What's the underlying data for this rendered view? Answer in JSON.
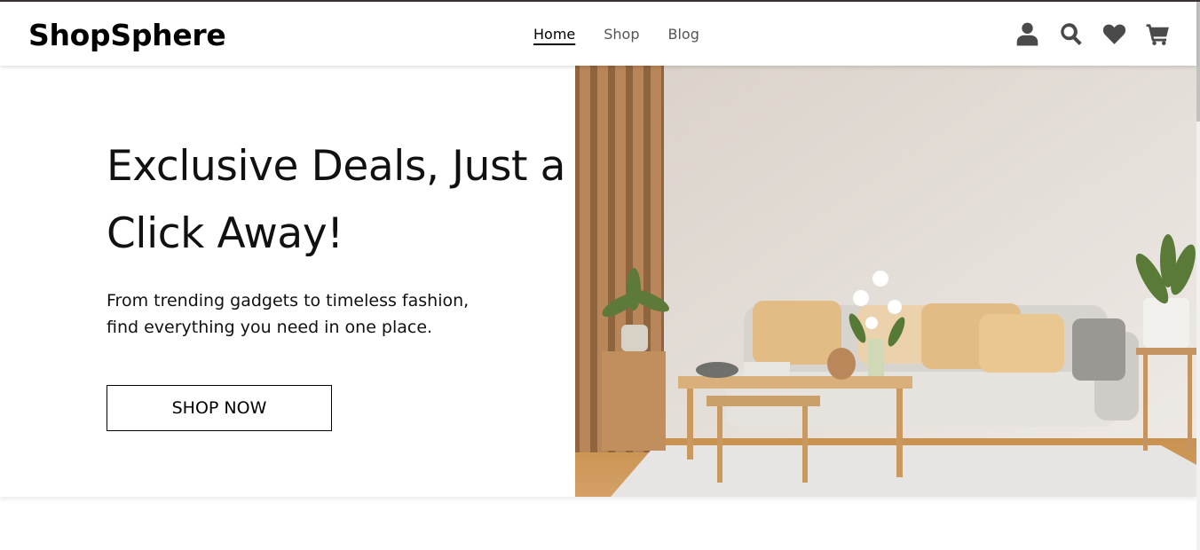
{
  "brand": {
    "name": "ShopSphere"
  },
  "nav": {
    "items": [
      "Home",
      "Shop",
      "Blog"
    ],
    "active": "Home"
  },
  "header_icons": [
    "user-icon",
    "search-icon",
    "heart-icon",
    "cart-icon"
  ],
  "hero": {
    "title": "Exclusive Deals, Just a Click Away!",
    "subtitle": "From trending gadgets to timeless fashion, find everything you need in one place.",
    "cta_label": "SHOP NOW",
    "image": "living-room-sofa-photo"
  },
  "colors": {
    "text": "#000000",
    "nav_inactive": "#555555",
    "icon": "#4a4a4a",
    "accent_sofa": "#e9c48e"
  }
}
